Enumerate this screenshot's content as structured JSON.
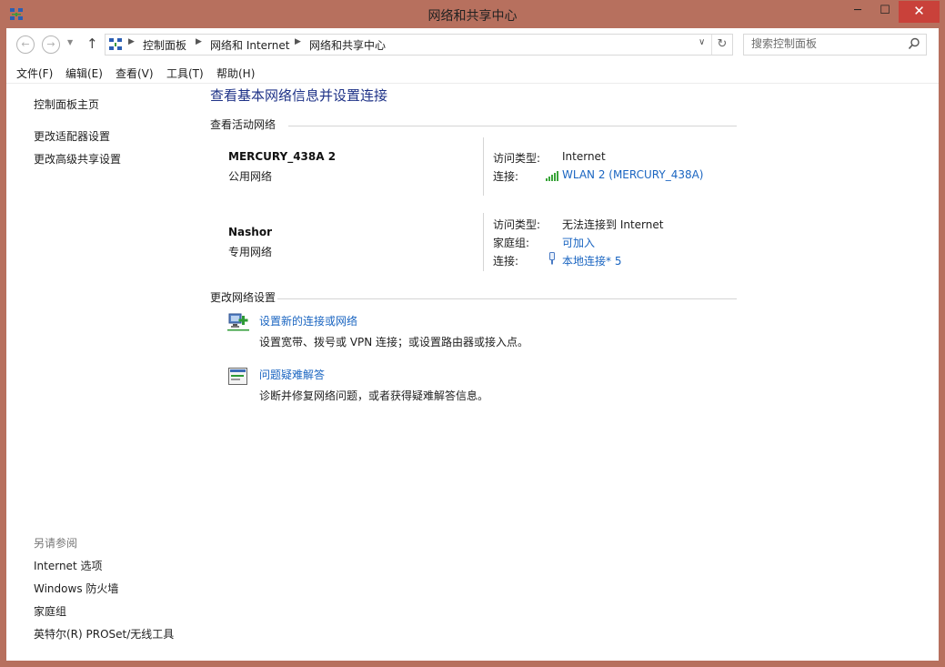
{
  "window": {
    "title": "网络和共享中心",
    "minimize": "─",
    "maximize": "☐",
    "close": "✕"
  },
  "nav": {
    "back": "←",
    "forward": "→",
    "recent": "▼",
    "up": "↑",
    "breadcrumbs": [
      "控制面板",
      "网络和 Internet",
      "网络和共享中心"
    ],
    "crumb_sep": "▶",
    "dropdown": "∨",
    "refresh": "↻",
    "search_placeholder": "搜索控制面板"
  },
  "menu": [
    "文件(F)",
    "编辑(E)",
    "查看(V)",
    "工具(T)",
    "帮助(H)"
  ],
  "sidebar": {
    "links": [
      "控制面板主页",
      "更改适配器设置",
      "更改高级共享设置"
    ],
    "see_also_heading": "另请参阅",
    "see_also": [
      "Internet 选项",
      "Windows 防火墙",
      "家庭组",
      "英特尔(R) PROSet/无线工具"
    ]
  },
  "main": {
    "title": "查看基本网络信息并设置连接",
    "active_networks_heading": "查看活动网络",
    "networks": [
      {
        "name": "MERCURY_438A  2",
        "category": "公用网络",
        "access_type_label": "访问类型:",
        "access_type": "Internet",
        "connection_label": "连接:",
        "connection": "WLAN 2 (MERCURY_438A)"
      },
      {
        "name": "Nashor",
        "category": "专用网络",
        "access_type_label": "访问类型:",
        "access_type": "无法连接到 Internet",
        "homegroup_label": "家庭组:",
        "homegroup": "可加入",
        "connection_label": "连接:",
        "connection": "本地连接* 5"
      }
    ],
    "change_settings_heading": "更改网络设置",
    "tasks": [
      {
        "link": "设置新的连接或网络",
        "desc": "设置宽带、拨号或 VPN 连接；或设置路由器或接入点。"
      },
      {
        "link": "问题疑难解答",
        "desc": "诊断并修复网络问题，或者获得疑难解答信息。"
      }
    ]
  },
  "colors": {
    "frame": "#b7705e",
    "link": "#1a65c1",
    "title": "#1e3287",
    "close": "#c9413a"
  }
}
